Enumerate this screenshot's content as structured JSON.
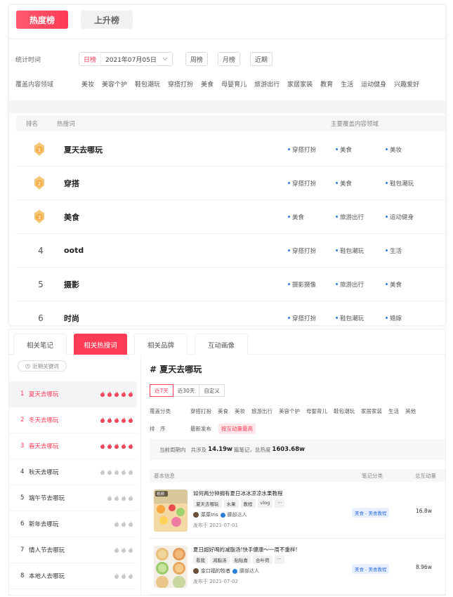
{
  "top": {
    "tabs": [
      {
        "label": "热度榜"
      },
      {
        "label": "上升榜"
      }
    ],
    "time_label": "统计时间",
    "day_label": "日榜",
    "date_value": "2021年07月05日",
    "week_label": "周榜",
    "month_label": "月榜",
    "recent_label": "近期",
    "domain_label": "覆盖内容领域",
    "domains": [
      "美妆",
      "美容个护",
      "鞋包潮玩",
      "穿搭打扮",
      "美食",
      "母婴育儿",
      "旅游出行",
      "家居家装",
      "教育",
      "生活",
      "运动健身",
      "兴趣爱好"
    ],
    "table_headers": {
      "rank": "排名",
      "word": "热搜词",
      "domains": "主要覆盖内容领域"
    },
    "rows": [
      {
        "rank": "",
        "word": "夏天去哪玩",
        "tags": [
          "穿搭打扮",
          "美食",
          "美妆"
        ]
      },
      {
        "rank": "",
        "word": "穿搭",
        "tags": [
          "穿搭打扮",
          "美食",
          "鞋包潮玩"
        ]
      },
      {
        "rank": "",
        "word": "美食",
        "tags": [
          "美食",
          "旅游出行",
          "运动健身"
        ]
      },
      {
        "rank": "4",
        "word": "ootd",
        "tags": [
          "穿搭打扮",
          "鞋包潮玩",
          "生活"
        ]
      },
      {
        "rank": "5",
        "word": "摄影",
        "tags": [
          "摄影摄像",
          "旅游出行",
          "美食"
        ]
      },
      {
        "rank": "6",
        "word": "时尚",
        "tags": [
          "穿搭打扮",
          "鞋包潮玩",
          "婚嫁"
        ]
      }
    ],
    "medal_numbers": [
      "1",
      "2",
      "3"
    ]
  },
  "bottom": {
    "tabs": [
      {
        "label": "相关笔记"
      },
      {
        "label": "相关热搜词"
      },
      {
        "label": "相关品牌"
      },
      {
        "label": "互动画像"
      }
    ],
    "recent_btn": "近期关键词",
    "keywords": [
      {
        "num": "1",
        "name": "夏天去哪玩",
        "flames": 5,
        "hot": true
      },
      {
        "num": "2",
        "name": "冬天去哪玩",
        "flames": 5,
        "hot": true
      },
      {
        "num": "3",
        "name": "春天去哪玩",
        "flames": 5,
        "hot": true
      },
      {
        "num": "4",
        "name": "秋天去哪玩",
        "flames": 5,
        "hot": false
      },
      {
        "num": "5",
        "name": "端午节去哪玩",
        "flames": 4,
        "hot": false
      },
      {
        "num": "6",
        "name": "新年去哪玩",
        "flames": 3,
        "hot": false
      },
      {
        "num": "7",
        "name": "情人节去哪玩",
        "flames": 3,
        "hot": false
      },
      {
        "num": "8",
        "name": "本地人去哪玩",
        "flames": 3,
        "hot": false
      }
    ],
    "title": "# 夏天去哪玩",
    "ranges": [
      "近7天",
      "近30天",
      "自定义"
    ],
    "cat_label": "覆盖分类",
    "cats": [
      "穿搭打扮",
      "美食",
      "美妆",
      "旅游出行",
      "美容个护",
      "母婴育儿",
      "鞋包潮玩",
      "家居家装",
      "生活",
      "其他"
    ],
    "sort_label": "排　序",
    "sorts": [
      "最新发布",
      "按互动量最高"
    ],
    "stat": {
      "prefix": "当前周期内",
      "mid1": "共涉及",
      "notes": "14.19w",
      "mid2": "篇笔记，总热度",
      "heat": "1603.68w"
    },
    "note_headers": {
      "info": "基本信息",
      "category": "笔记分类",
      "interaction": "总互动量"
    },
    "notes": [
      {
        "title": "如何两分钟拥有夏日冰冰凉凉水果教程",
        "tags": [
          "夏天去哪玩",
          "水果",
          "教程",
          "vlog",
          "···"
        ],
        "author": "菜菜Iris",
        "level": "腰部达人",
        "date": "发布于 2021-07-01",
        "category": "美食 - 美食教程",
        "value": "16.8w",
        "thumb_badge": "视频"
      },
      {
        "title": "夏日超好喝的减脂汤!快手健康～一周不重样!",
        "tags": [
          "看我",
          "减脂汤",
          "贴贴喜",
          "合叶荷",
          "···"
        ],
        "author": "金口福的牧者",
        "level": "腰部达人",
        "date": "发布于 2021-07-02",
        "category": "美食 - 美食教程",
        "value": "8.96w"
      }
    ]
  }
}
